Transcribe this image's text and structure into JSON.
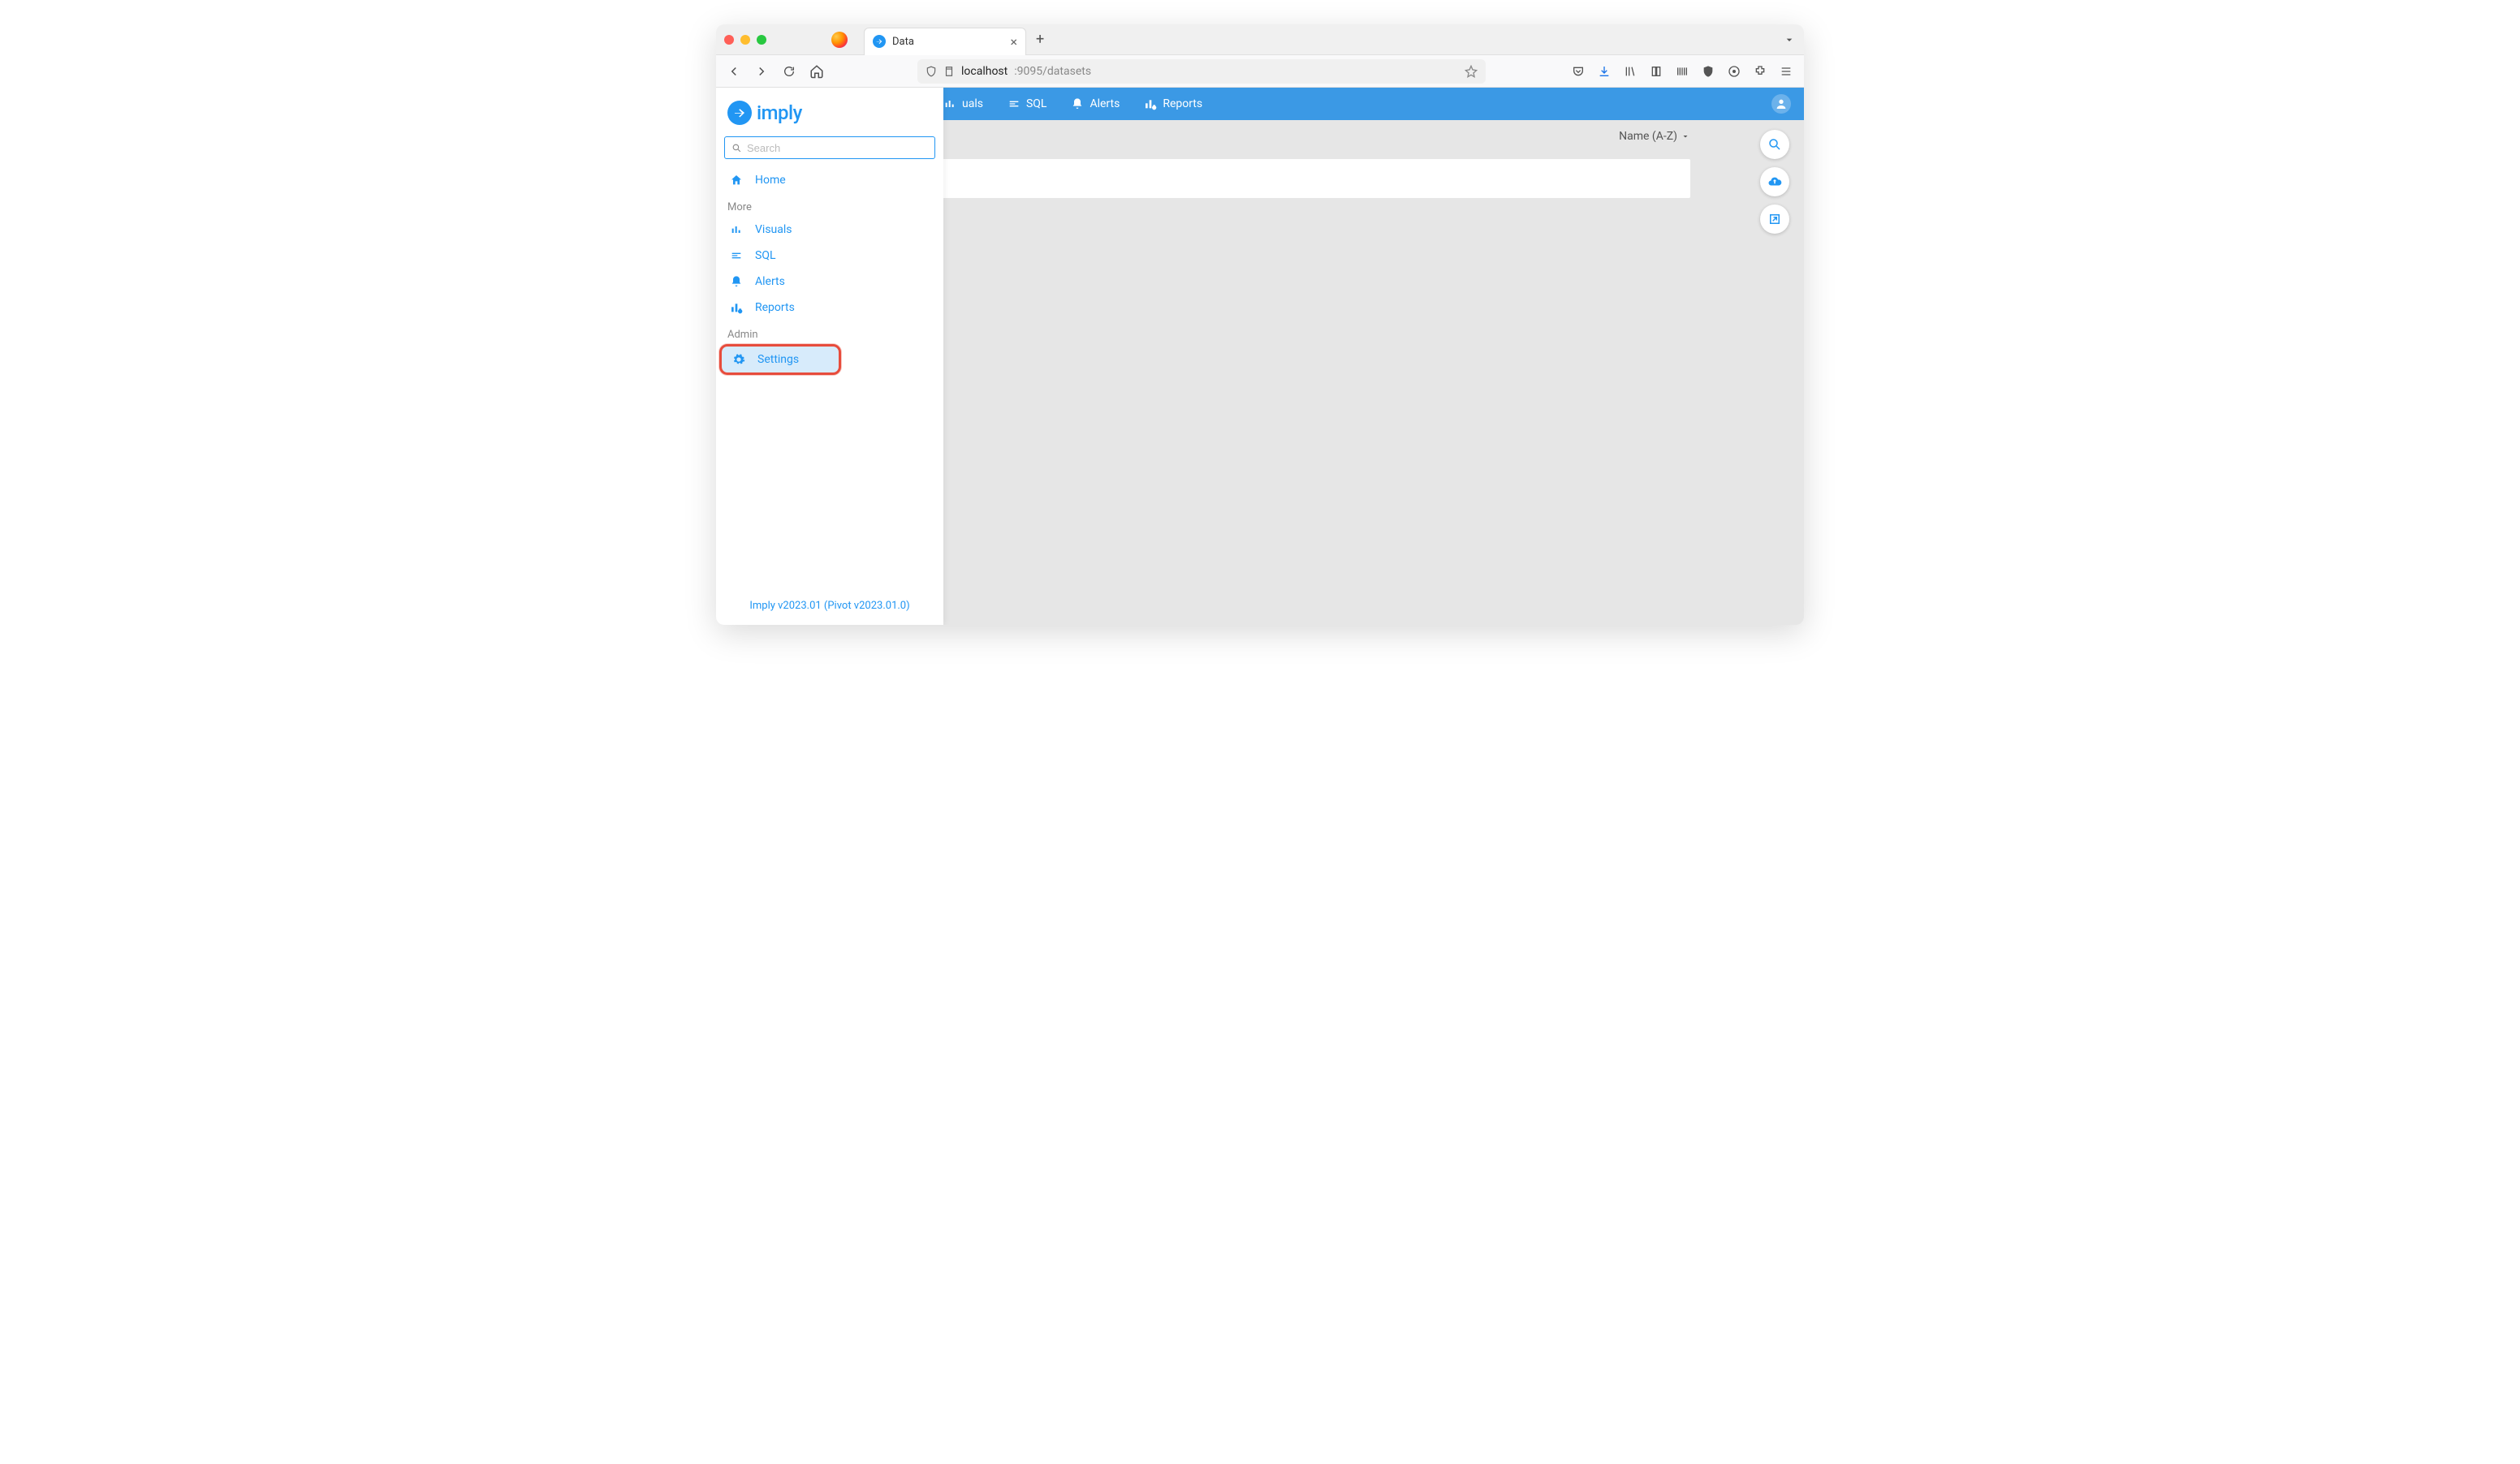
{
  "browser": {
    "tab_title": "Data",
    "url_host": "localhost",
    "url_rest": ":9095/datasets"
  },
  "topnav": {
    "items": [
      "uals",
      "SQL",
      "Alerts",
      "Reports"
    ]
  },
  "sidebar": {
    "brand": "imply",
    "search_placeholder": "Search",
    "home_label": "Home",
    "section_more": "More",
    "more_items": [
      {
        "label": "Visuals"
      },
      {
        "label": "SQL"
      },
      {
        "label": "Alerts"
      },
      {
        "label": "Reports"
      }
    ],
    "section_admin": "Admin",
    "settings_label": "Settings",
    "footer": "Imply v2023.01 (Pivot v2023.01.0)"
  },
  "content": {
    "sort_label": "Name (A-Z)"
  }
}
